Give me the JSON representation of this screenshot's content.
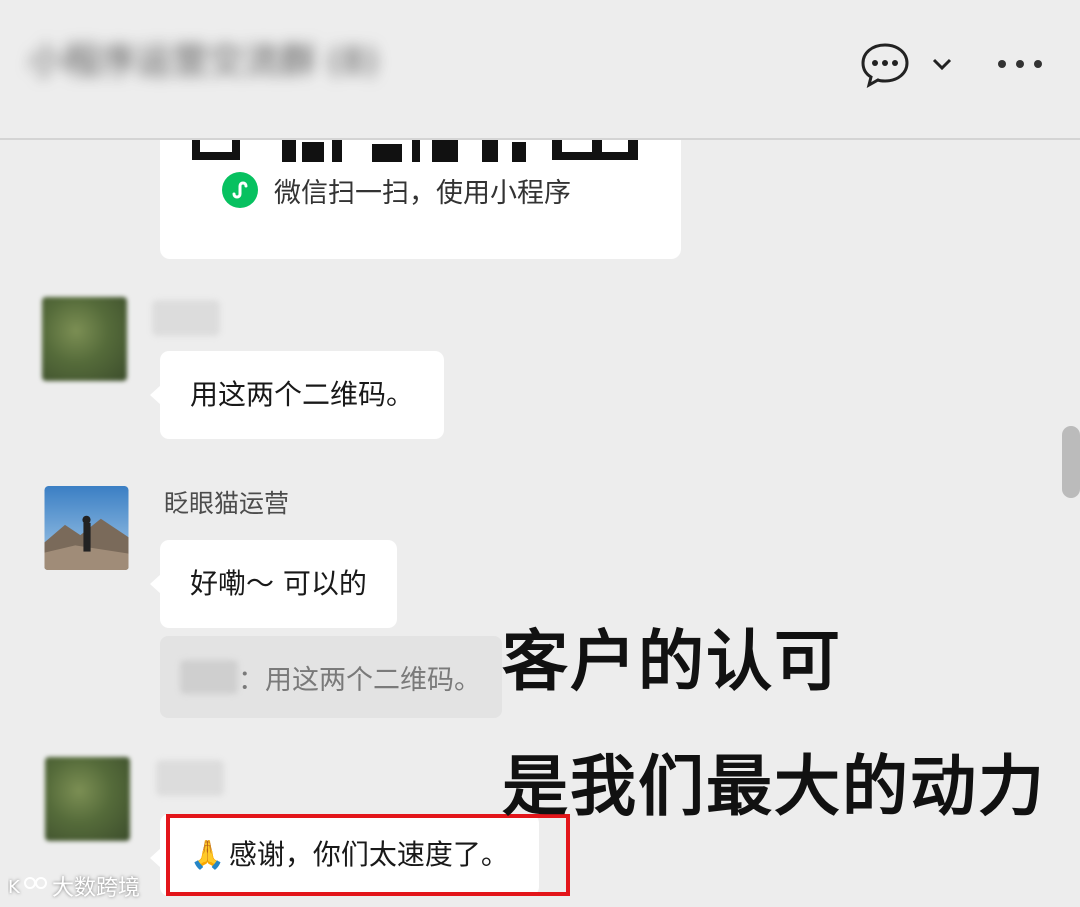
{
  "header": {
    "chat_title": "小程序运营交流群 (8)",
    "chat_icon": "chat-bubble-icon",
    "chevron_icon": "chevron-down-icon",
    "more_icon": "more-dots-icon"
  },
  "mini_program_card": {
    "caption": "微信扫一扫，使用小程序",
    "logo_icon": "mini-program-icon",
    "logo_color": "#07c160"
  },
  "messages": [
    {
      "sender": "",
      "text": "用这两个二维码。"
    },
    {
      "sender": "眨眼猫运营",
      "text": "好嘞～ 可以的",
      "quote": "：用这两个二维码。"
    },
    {
      "sender": "",
      "text": "感谢，你们太速度了。",
      "emoji": "🙏"
    }
  ],
  "overlay": {
    "line1": "客户的认可",
    "line2": "是我们最大的动力"
  },
  "highlight_color": "#e3151a",
  "watermark": {
    "text": "大数跨境"
  }
}
